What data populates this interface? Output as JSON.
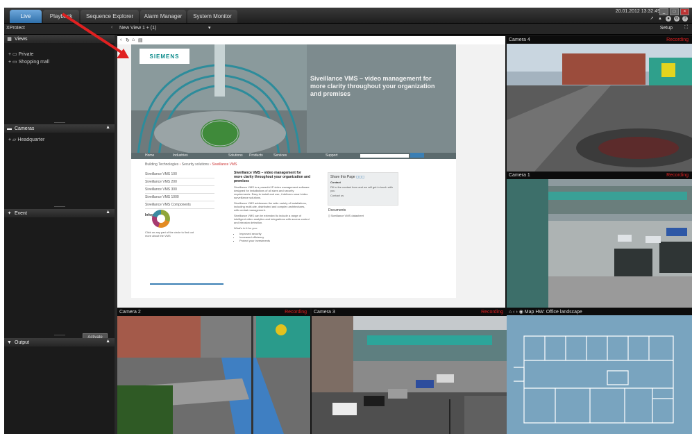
{
  "top": {
    "tabs": [
      "Live",
      "Playback",
      "Sequence Explorer",
      "Alarm Manager",
      "System Monitor"
    ],
    "active_tab": "Live",
    "clock": "20.01.2012 13:32:49",
    "win_min": "_",
    "win_max": "□",
    "win_close": "×"
  },
  "bar2": {
    "left_label": "XProtect",
    "view_name": "New View 1 + (1)",
    "setup": "Setup"
  },
  "sidebar": {
    "views": {
      "title": "Views",
      "items": [
        "Private",
        "Shopping mall"
      ]
    },
    "cameras": {
      "title": "Cameras",
      "items": [
        "Headquarter"
      ]
    },
    "event": {
      "title": "Event",
      "button": "Activate"
    },
    "output": {
      "title": "Output"
    }
  },
  "webtile": {
    "logo": "SIEMENS",
    "hero_text": "Siveillance VMS – video management for more clarity throughout your organization and premises",
    "nav": [
      "Home",
      "Industries",
      "Solutions",
      "Products",
      "Services",
      "Support"
    ],
    "breadcrumb": [
      "Building Technologies",
      "Security solutions",
      "Siveillance VMS"
    ],
    "left_nav": [
      "Siveillance VMS 100",
      "Siveillance VMS 200",
      "Siveillance VMS 300",
      "Siveillance VMS 1000",
      "Siveillance VMS Components"
    ],
    "images_title": "Infographic",
    "image_caption": "Click on any part of the circle to find out more about the VMS",
    "content_title": "Siveillance VMS – video management for more clarity throughout your organization and premises",
    "content_paras": [
      "Siveillance VMS is a powerful IP video management software designed for installations of all sizes and security requirements. Easy to install and use, it delivers smart video surveillance solutions.",
      "Siveillance VMS addresses the wide variety of installations, including multi-site, distributed and complex architectures, with central management.",
      "Siveillance VMS can be extended to include a range of intelligent video analytics and integrations with access control and intrusion detection."
    ],
    "content_bullets_title": "What's in it for you:",
    "content_bullets": [
      "Improved security",
      "Increased efficiency",
      "Protect your investments"
    ],
    "share_title": "Share this Page",
    "contact_title": "Contact",
    "contact_text": "Fill in the contact form and we will get in touch with you",
    "contact_link": "Contact us",
    "docs_title": "Documents",
    "docs_item": "Siveillance VMS datasheet"
  },
  "tiles": {
    "cam4": {
      "name": "Camera 4",
      "status": "Recording"
    },
    "cam1": {
      "name": "Camera 1",
      "status": "Recording"
    },
    "cam2": {
      "name": "Camera 2",
      "status": "Recording"
    },
    "cam3": {
      "name": "Camera 3",
      "status": "Recording"
    },
    "map": {
      "name": "Map HW: Office landscape"
    }
  },
  "colors": {
    "accent": "#2f6faa",
    "recording": "#e02020",
    "map_bg": "#79a4bf",
    "annotation_arrow": "#e02020"
  }
}
